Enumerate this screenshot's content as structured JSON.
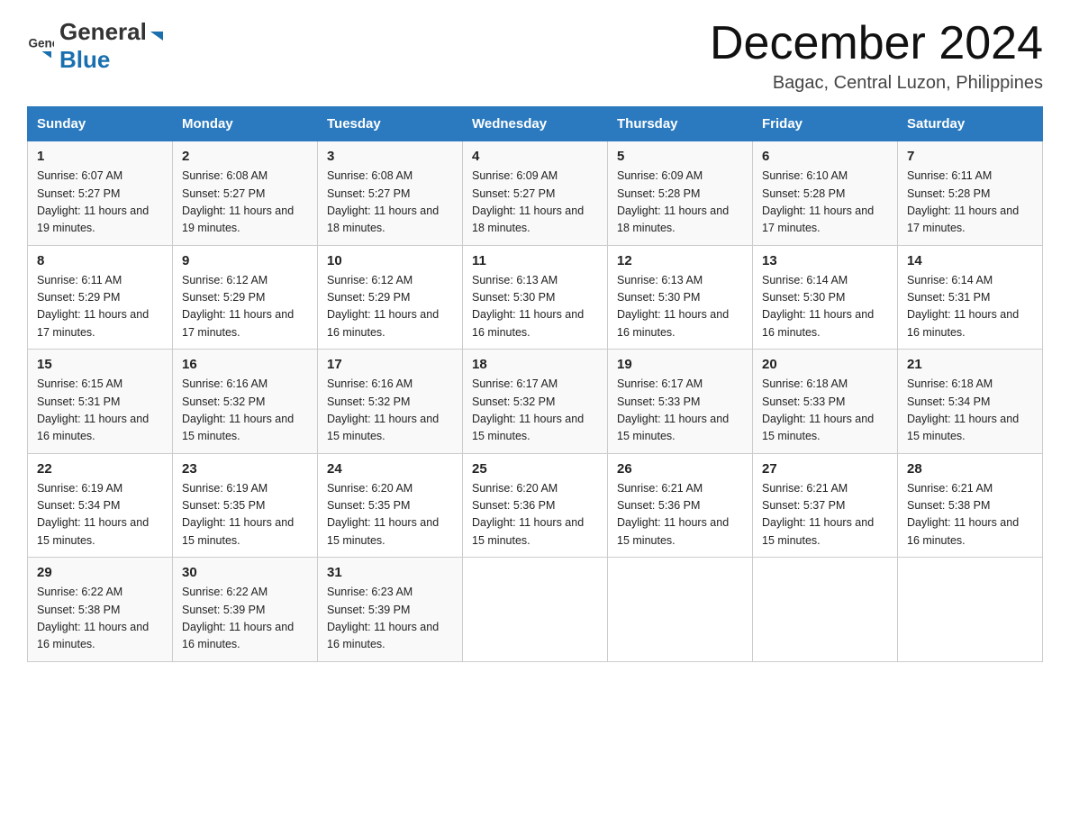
{
  "header": {
    "logo_general": "General",
    "logo_blue": "Blue",
    "month_title": "December 2024",
    "location": "Bagac, Central Luzon, Philippines"
  },
  "weekdays": [
    "Sunday",
    "Monday",
    "Tuesday",
    "Wednesday",
    "Thursday",
    "Friday",
    "Saturday"
  ],
  "weeks": [
    [
      {
        "day": "1",
        "sunrise": "6:07 AM",
        "sunset": "5:27 PM",
        "daylight": "11 hours and 19 minutes."
      },
      {
        "day": "2",
        "sunrise": "6:08 AM",
        "sunset": "5:27 PM",
        "daylight": "11 hours and 19 minutes."
      },
      {
        "day": "3",
        "sunrise": "6:08 AM",
        "sunset": "5:27 PM",
        "daylight": "11 hours and 18 minutes."
      },
      {
        "day": "4",
        "sunrise": "6:09 AM",
        "sunset": "5:27 PM",
        "daylight": "11 hours and 18 minutes."
      },
      {
        "day": "5",
        "sunrise": "6:09 AM",
        "sunset": "5:28 PM",
        "daylight": "11 hours and 18 minutes."
      },
      {
        "day": "6",
        "sunrise": "6:10 AM",
        "sunset": "5:28 PM",
        "daylight": "11 hours and 17 minutes."
      },
      {
        "day": "7",
        "sunrise": "6:11 AM",
        "sunset": "5:28 PM",
        "daylight": "11 hours and 17 minutes."
      }
    ],
    [
      {
        "day": "8",
        "sunrise": "6:11 AM",
        "sunset": "5:29 PM",
        "daylight": "11 hours and 17 minutes."
      },
      {
        "day": "9",
        "sunrise": "6:12 AM",
        "sunset": "5:29 PM",
        "daylight": "11 hours and 17 minutes."
      },
      {
        "day": "10",
        "sunrise": "6:12 AM",
        "sunset": "5:29 PM",
        "daylight": "11 hours and 16 minutes."
      },
      {
        "day": "11",
        "sunrise": "6:13 AM",
        "sunset": "5:30 PM",
        "daylight": "11 hours and 16 minutes."
      },
      {
        "day": "12",
        "sunrise": "6:13 AM",
        "sunset": "5:30 PM",
        "daylight": "11 hours and 16 minutes."
      },
      {
        "day": "13",
        "sunrise": "6:14 AM",
        "sunset": "5:30 PM",
        "daylight": "11 hours and 16 minutes."
      },
      {
        "day": "14",
        "sunrise": "6:14 AM",
        "sunset": "5:31 PM",
        "daylight": "11 hours and 16 minutes."
      }
    ],
    [
      {
        "day": "15",
        "sunrise": "6:15 AM",
        "sunset": "5:31 PM",
        "daylight": "11 hours and 16 minutes."
      },
      {
        "day": "16",
        "sunrise": "6:16 AM",
        "sunset": "5:32 PM",
        "daylight": "11 hours and 15 minutes."
      },
      {
        "day": "17",
        "sunrise": "6:16 AM",
        "sunset": "5:32 PM",
        "daylight": "11 hours and 15 minutes."
      },
      {
        "day": "18",
        "sunrise": "6:17 AM",
        "sunset": "5:32 PM",
        "daylight": "11 hours and 15 minutes."
      },
      {
        "day": "19",
        "sunrise": "6:17 AM",
        "sunset": "5:33 PM",
        "daylight": "11 hours and 15 minutes."
      },
      {
        "day": "20",
        "sunrise": "6:18 AM",
        "sunset": "5:33 PM",
        "daylight": "11 hours and 15 minutes."
      },
      {
        "day": "21",
        "sunrise": "6:18 AM",
        "sunset": "5:34 PM",
        "daylight": "11 hours and 15 minutes."
      }
    ],
    [
      {
        "day": "22",
        "sunrise": "6:19 AM",
        "sunset": "5:34 PM",
        "daylight": "11 hours and 15 minutes."
      },
      {
        "day": "23",
        "sunrise": "6:19 AM",
        "sunset": "5:35 PM",
        "daylight": "11 hours and 15 minutes."
      },
      {
        "day": "24",
        "sunrise": "6:20 AM",
        "sunset": "5:35 PM",
        "daylight": "11 hours and 15 minutes."
      },
      {
        "day": "25",
        "sunrise": "6:20 AM",
        "sunset": "5:36 PM",
        "daylight": "11 hours and 15 minutes."
      },
      {
        "day": "26",
        "sunrise": "6:21 AM",
        "sunset": "5:36 PM",
        "daylight": "11 hours and 15 minutes."
      },
      {
        "day": "27",
        "sunrise": "6:21 AM",
        "sunset": "5:37 PM",
        "daylight": "11 hours and 15 minutes."
      },
      {
        "day": "28",
        "sunrise": "6:21 AM",
        "sunset": "5:38 PM",
        "daylight": "11 hours and 16 minutes."
      }
    ],
    [
      {
        "day": "29",
        "sunrise": "6:22 AM",
        "sunset": "5:38 PM",
        "daylight": "11 hours and 16 minutes."
      },
      {
        "day": "30",
        "sunrise": "6:22 AM",
        "sunset": "5:39 PM",
        "daylight": "11 hours and 16 minutes."
      },
      {
        "day": "31",
        "sunrise": "6:23 AM",
        "sunset": "5:39 PM",
        "daylight": "11 hours and 16 minutes."
      },
      null,
      null,
      null,
      null
    ]
  ]
}
